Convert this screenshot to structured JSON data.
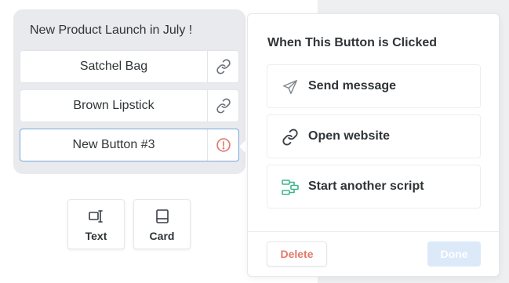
{
  "message": {
    "text": "New Product Launch in July !"
  },
  "buttons": [
    {
      "label": "Satchel Bag",
      "icon": "link-icon",
      "status": "linked"
    },
    {
      "label": "Brown Lipstick",
      "icon": "link-icon",
      "status": "linked"
    },
    {
      "label": "New Button #3",
      "icon": "alert-icon",
      "status": "unconfigured"
    }
  ],
  "tools": [
    {
      "label": "Text",
      "icon": "text-cursor-icon"
    },
    {
      "label": "Card",
      "icon": "card-icon"
    }
  ],
  "panel": {
    "title": "When This Button is Clicked",
    "options": [
      {
        "label": "Send message",
        "icon": "paper-plane-icon"
      },
      {
        "label": "Open website",
        "icon": "link-icon"
      },
      {
        "label": "Start another script",
        "icon": "flow-icon"
      }
    ],
    "delete_label": "Delete",
    "done_label": "Done"
  },
  "colors": {
    "accent_border": "#7aa9dd",
    "alert": "#e27a6c",
    "script_icon": "#3fb58a",
    "done_disabled_bg": "#dce9f8"
  }
}
